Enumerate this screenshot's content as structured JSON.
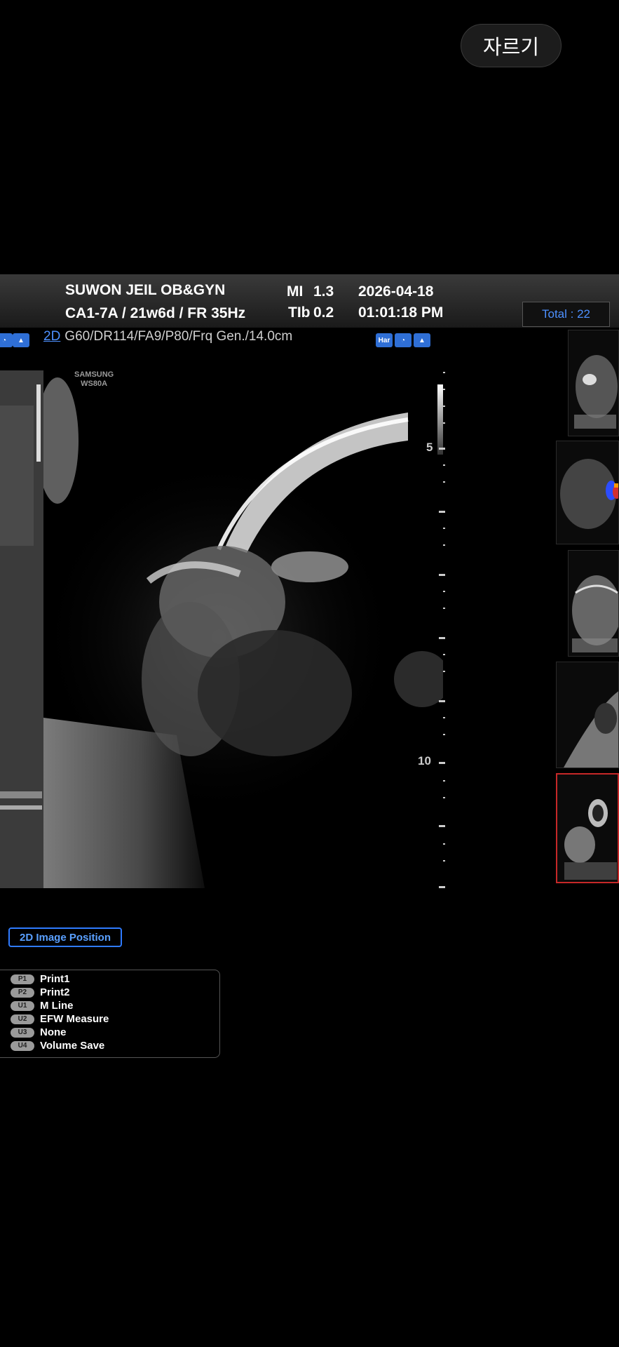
{
  "crop_button": "자르기",
  "header": {
    "institution": "SUWON JEIL OB&GYN",
    "probe_info": "CA1-7A / 21w6d / FR 35Hz",
    "mi_label": "MI",
    "mi_value": "1.3",
    "tib_label": "TIb",
    "tib_value": "0.2",
    "date": "2026-04-18",
    "time": "01:01:18 PM",
    "total": "Total : 22"
  },
  "params": {
    "mode": "2D",
    "values": "G60/DR114/FA9/P80/Frq Gen./14.0cm"
  },
  "icons": {
    "har": "Har"
  },
  "brand": [
    "SAMSUNG",
    "WS80A"
  ],
  "depth_labels": [
    "5",
    "10"
  ],
  "image_position_button": "2D Image Position",
  "user_keys": [
    {
      "key": "P1",
      "label": "Print1"
    },
    {
      "key": "P2",
      "label": "Print2"
    },
    {
      "key": "U1",
      "label": "M Line"
    },
    {
      "key": "U2",
      "label": "EFW Measure"
    },
    {
      "key": "U3",
      "label": "None"
    },
    {
      "key": "U4",
      "label": "Volume Save"
    }
  ],
  "accent_blue": "#2f7bff",
  "selected_thumb_color": "#c62828"
}
